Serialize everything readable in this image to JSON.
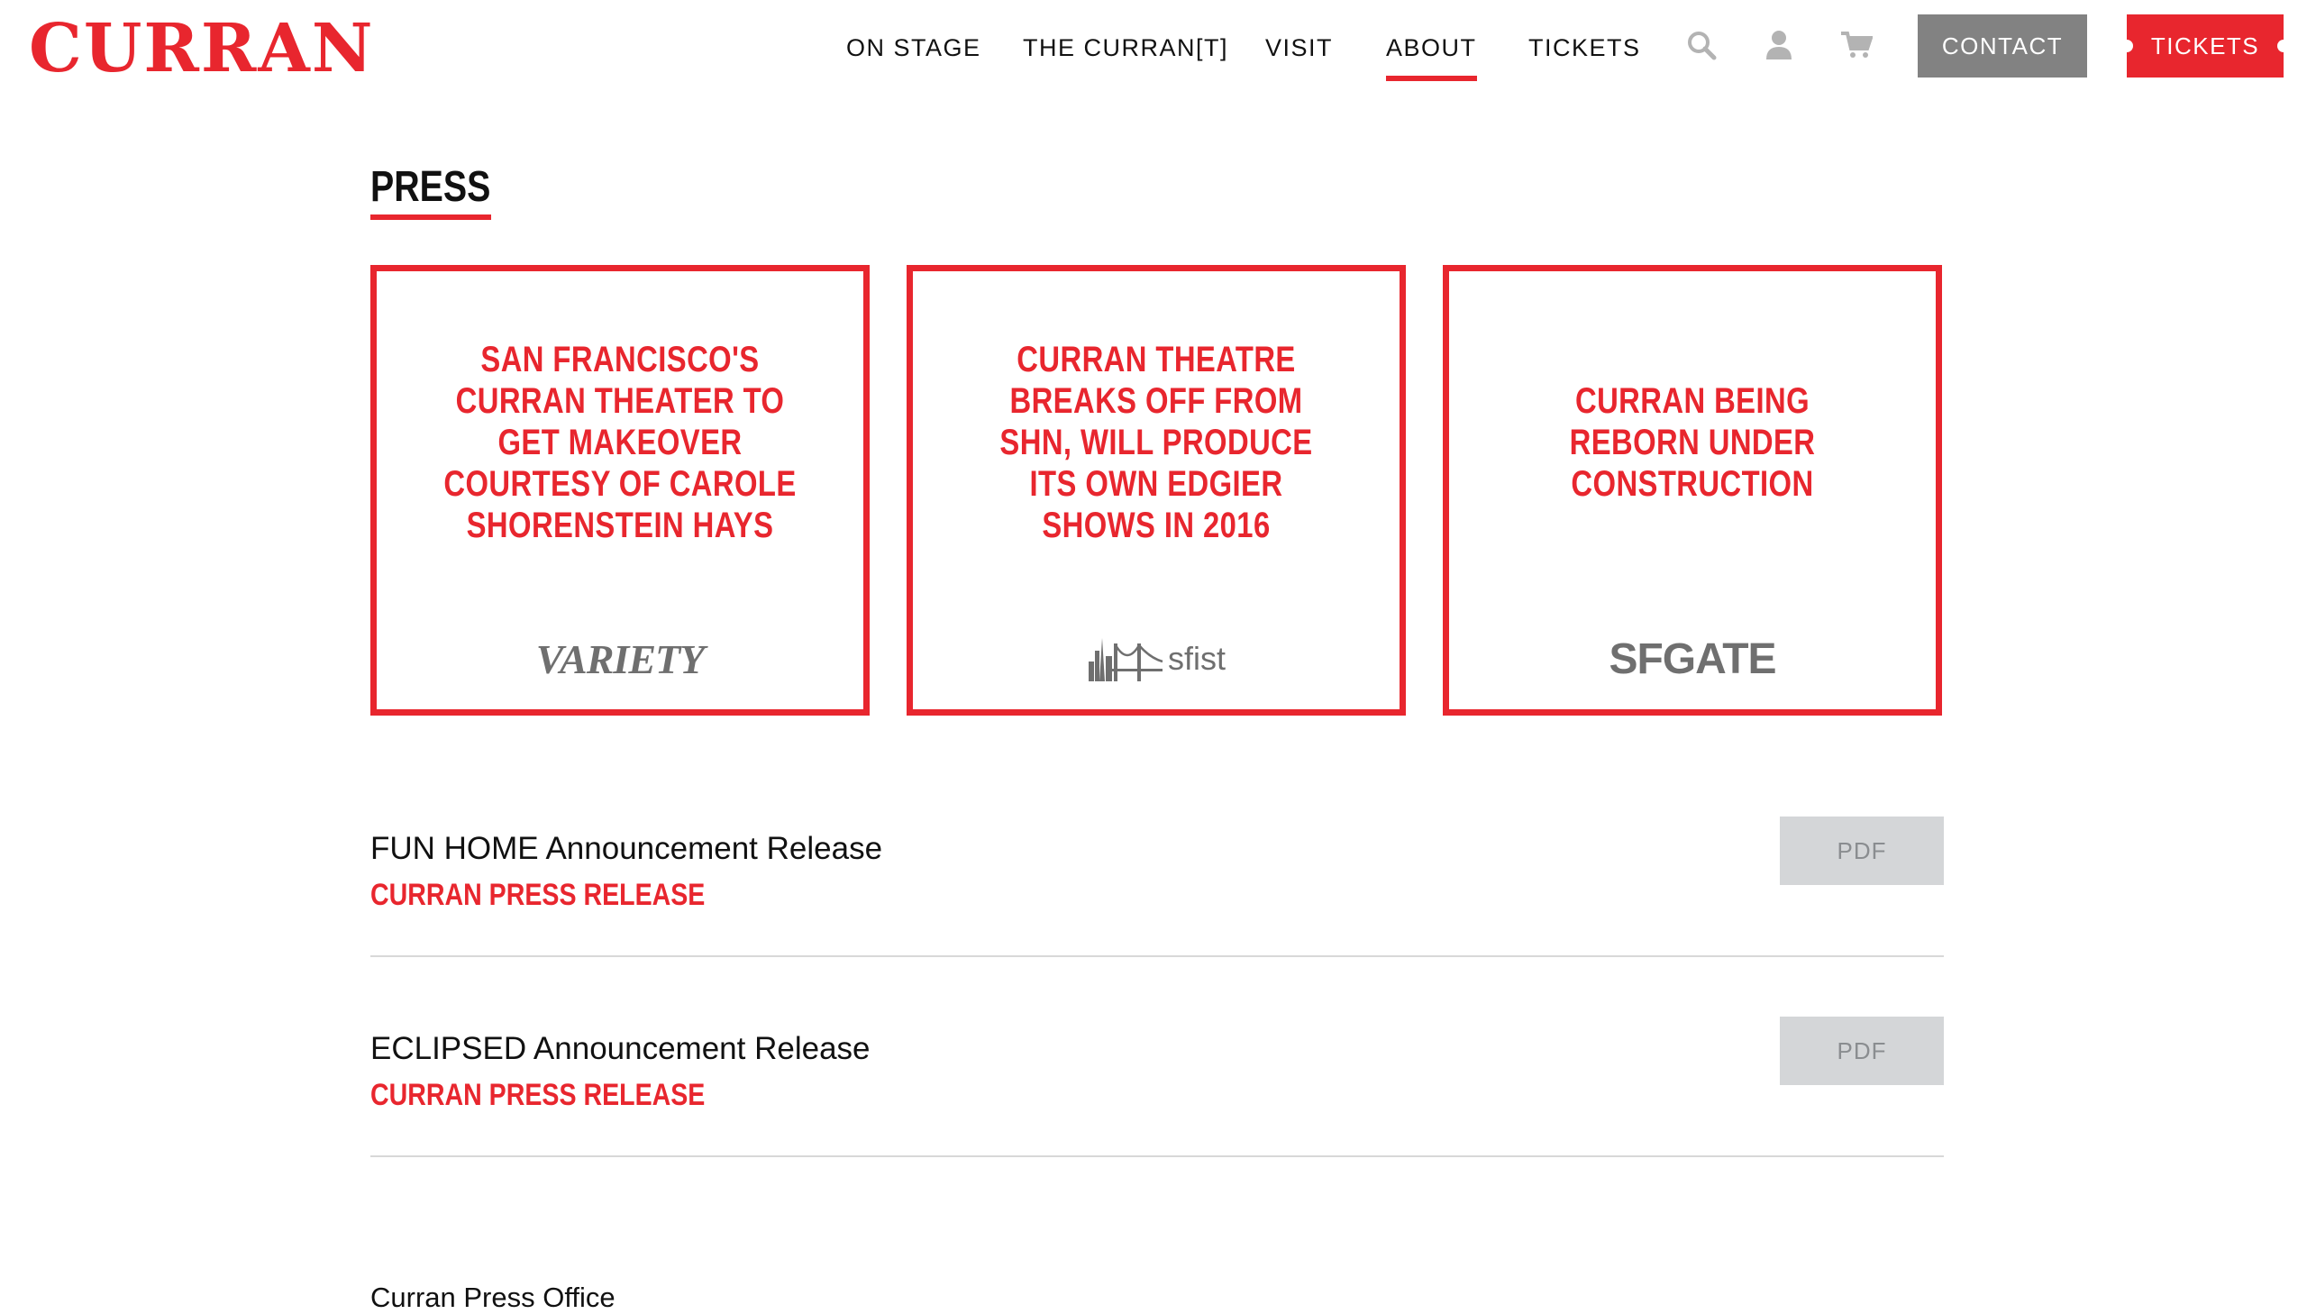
{
  "header": {
    "logo": "CURRAN",
    "nav": [
      "ON STAGE",
      "THE CURRAN[T]",
      "VISIT",
      "ABOUT",
      "TICKETS"
    ],
    "active_nav": "ABOUT",
    "icons": [
      "search-icon",
      "user-icon",
      "cart-icon"
    ],
    "contact_label": "CONTACT",
    "tickets_label": "TICKETS"
  },
  "page": {
    "title": "PRESS"
  },
  "cards": [
    {
      "headline": "SAN FRANCISCO'S CURRAN THEATER TO GET MAKEOVER COURTESY OF CAROLE SHORENSTEIN HAYS",
      "source": "VARIETY"
    },
    {
      "headline": "CURRAN THEATRE BREAKS OFF FROM SHN, WILL PRODUCE ITS OWN EDGIER SHOWS IN 2016",
      "source": "sfist"
    },
    {
      "headline": "CURRAN BEING REBORN UNDER CONSTRUCTION",
      "source": "SFGATE"
    }
  ],
  "releases": [
    {
      "title": "FUN HOME Announcement Release",
      "source": "CURRAN PRESS RELEASE",
      "button": "PDF"
    },
    {
      "title": "ECLIPSED Announcement Release",
      "source": "CURRAN PRESS RELEASE",
      "button": "PDF"
    }
  ],
  "footer": {
    "press_office": "Curran Press Office"
  },
  "colors": {
    "accent": "#e8262e",
    "contact_bg": "#828282",
    "pdf_bg": "#d4d6d8"
  }
}
